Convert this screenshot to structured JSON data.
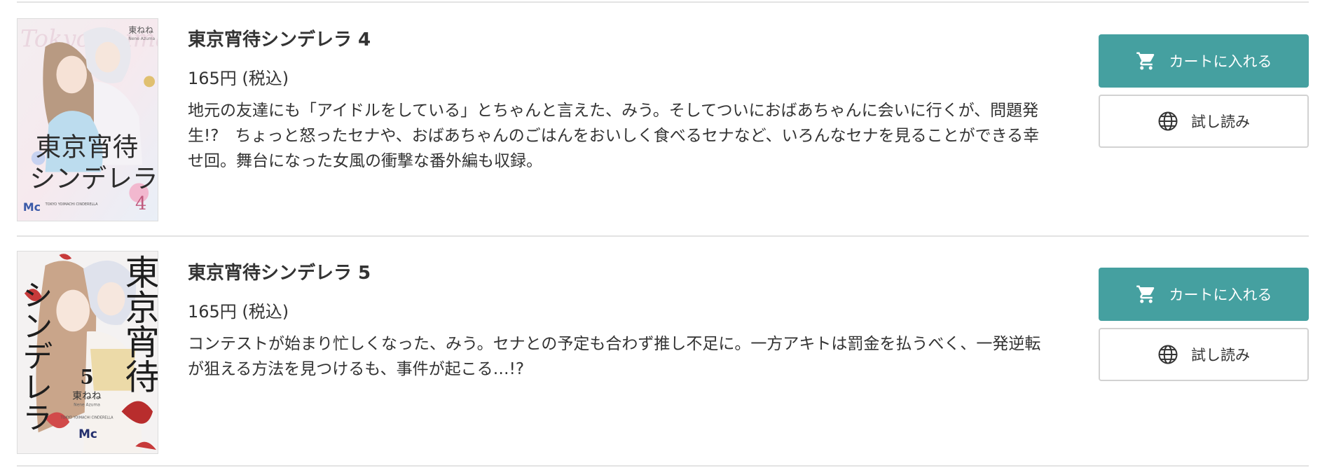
{
  "items": [
    {
      "title": "東京宵待シンデレラ 4",
      "price": "165円 (税込)",
      "description": "地元の友達にも「アイドルをしている」とちゃんと言えた、みう。そしてついにおばあちゃんに会いに行くが、問題発生!?　ちょっと怒ったセナや、おばあちゃんのごはんをおいしく食べるセナなど、いろんなセナを見ることができる幸せ回。舞台になった女風の衝撃な番外編も収録。",
      "cart_label": "カートに入れる",
      "read_label": "試し読み",
      "cover": {
        "title_line1": "東京宵待",
        "title_line2": "シンデレラ",
        "volume": "4",
        "author": "東ねね",
        "author_roman": "Nene Azuma",
        "script": "Tokyo Yoimachi",
        "publisher": "Mc",
        "subtitle": "TOKYO YOIMACHI CINDERELLA"
      }
    },
    {
      "title": "東京宵待シンデレラ 5",
      "price": "165円 (税込)",
      "description": "コンテストが始まり忙しくなった、みう。セナとの予定も合わず推し不足に。一方アキトは罰金を払うべく、一発逆転が狙える方法を見つけるも、事件が起こる…!?",
      "cart_label": "カートに入れる",
      "read_label": "試し読み",
      "cover": {
        "title_vertical_right": "東京宵待",
        "title_vertical_left": "シンデレラ",
        "volume": "5",
        "author": "東ねね",
        "author_roman": "Nene Azuma",
        "publisher": "Mc",
        "subtitle": "TOKYO YOIMACHI CINDERELLA"
      }
    }
  ],
  "icons": {
    "cart": "cart-icon",
    "globe": "globe-icon"
  },
  "colors": {
    "cart_button": "#45a0a0",
    "divider": "#e3e3e3",
    "text": "#333333"
  }
}
